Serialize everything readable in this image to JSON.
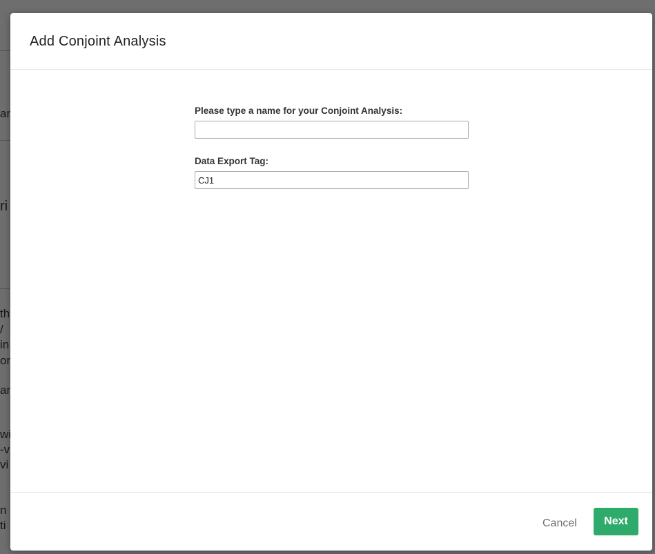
{
  "background": {
    "fragments": [
      "ar",
      "ri",
      "th",
      "/",
      "in",
      "or",
      "ar",
      "wi",
      "-v",
      "vi",
      "n",
      "ti"
    ]
  },
  "modal": {
    "title": "Add Conjoint Analysis",
    "fields": {
      "name": {
        "label": "Please type a name for your Conjoint Analysis:",
        "value": "",
        "placeholder": ""
      },
      "export_tag": {
        "label": "Data Export Tag:",
        "value": "CJ1"
      }
    },
    "footer": {
      "cancel_label": "Cancel",
      "next_label": "Next"
    }
  },
  "colors": {
    "primary_button": "#2eab6a",
    "overlay": "#777777"
  }
}
